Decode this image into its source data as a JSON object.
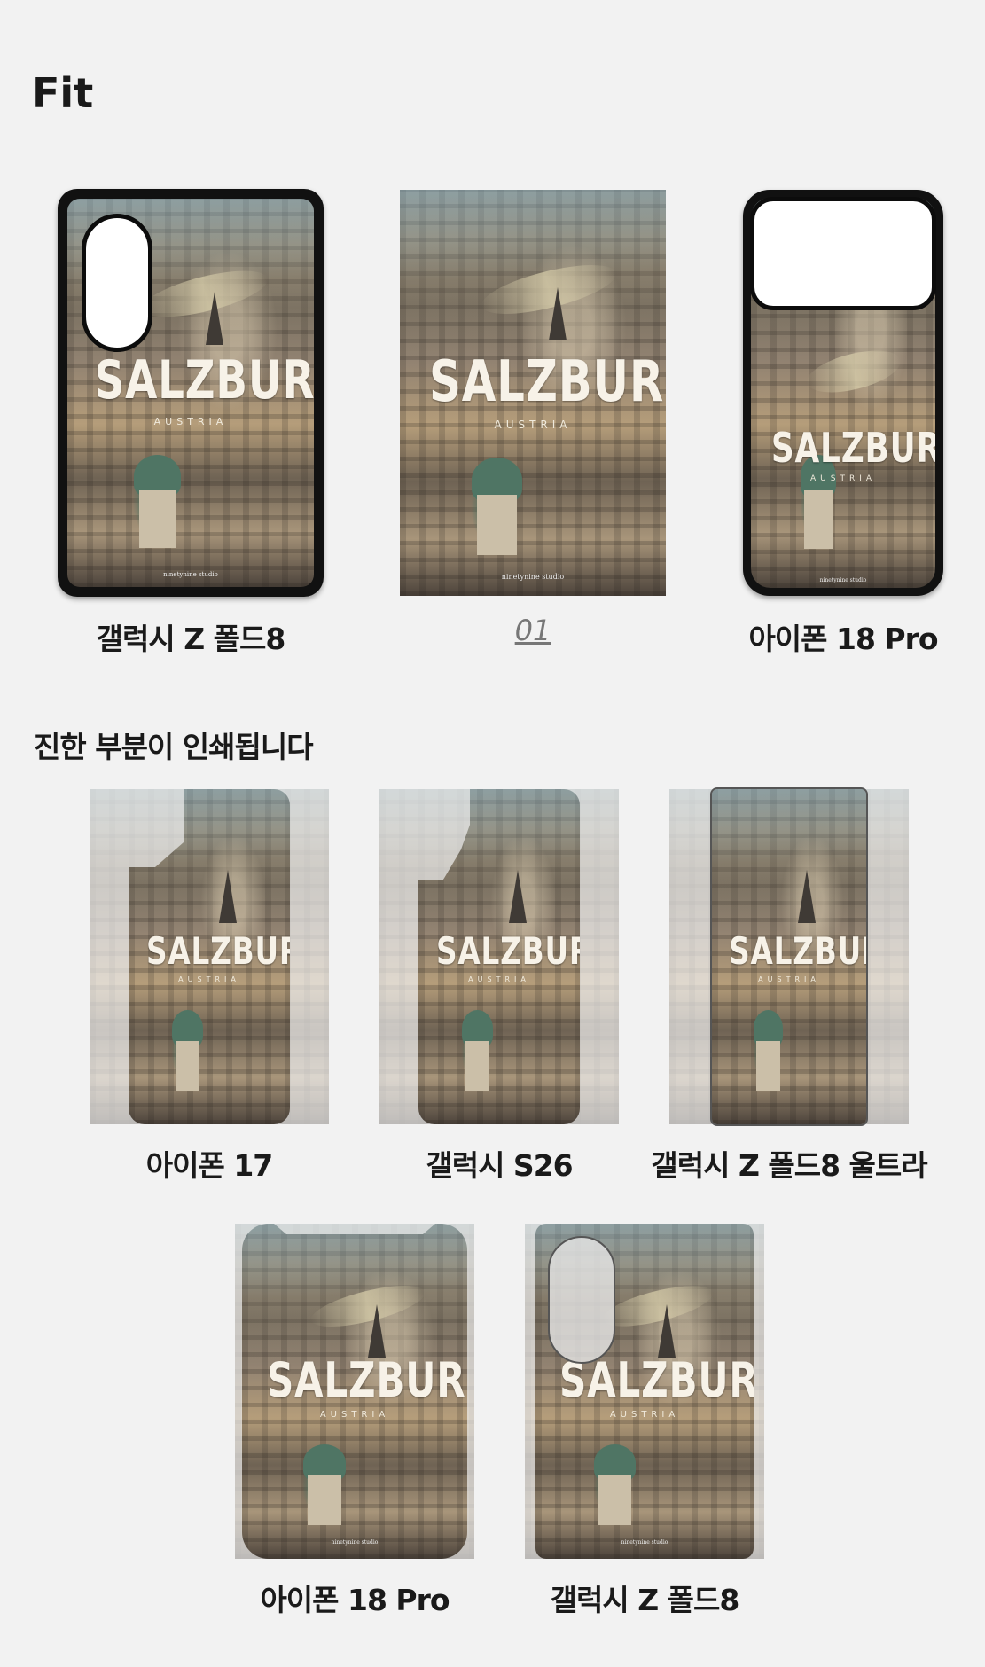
{
  "page_title": "Fit",
  "print_note": "진한 부분이 인쇄됩니다",
  "poster": {
    "word": "SALZBURG",
    "subword": "AUSTRIA",
    "studio": "ninetynine studio"
  },
  "row1": [
    {
      "label": "갤럭시 Z 폴드8"
    },
    {
      "label": "01"
    },
    {
      "label": "아이폰 18 Pro"
    }
  ],
  "row2": [
    {
      "label": "아이폰 17"
    },
    {
      "label": "갤럭시 S26"
    },
    {
      "label": "갤럭시 Z 폴드8 울트라"
    }
  ],
  "row3": [
    {
      "label": "아이폰 18 Pro"
    },
    {
      "label": "갤럭시 Z 폴드8"
    }
  ]
}
